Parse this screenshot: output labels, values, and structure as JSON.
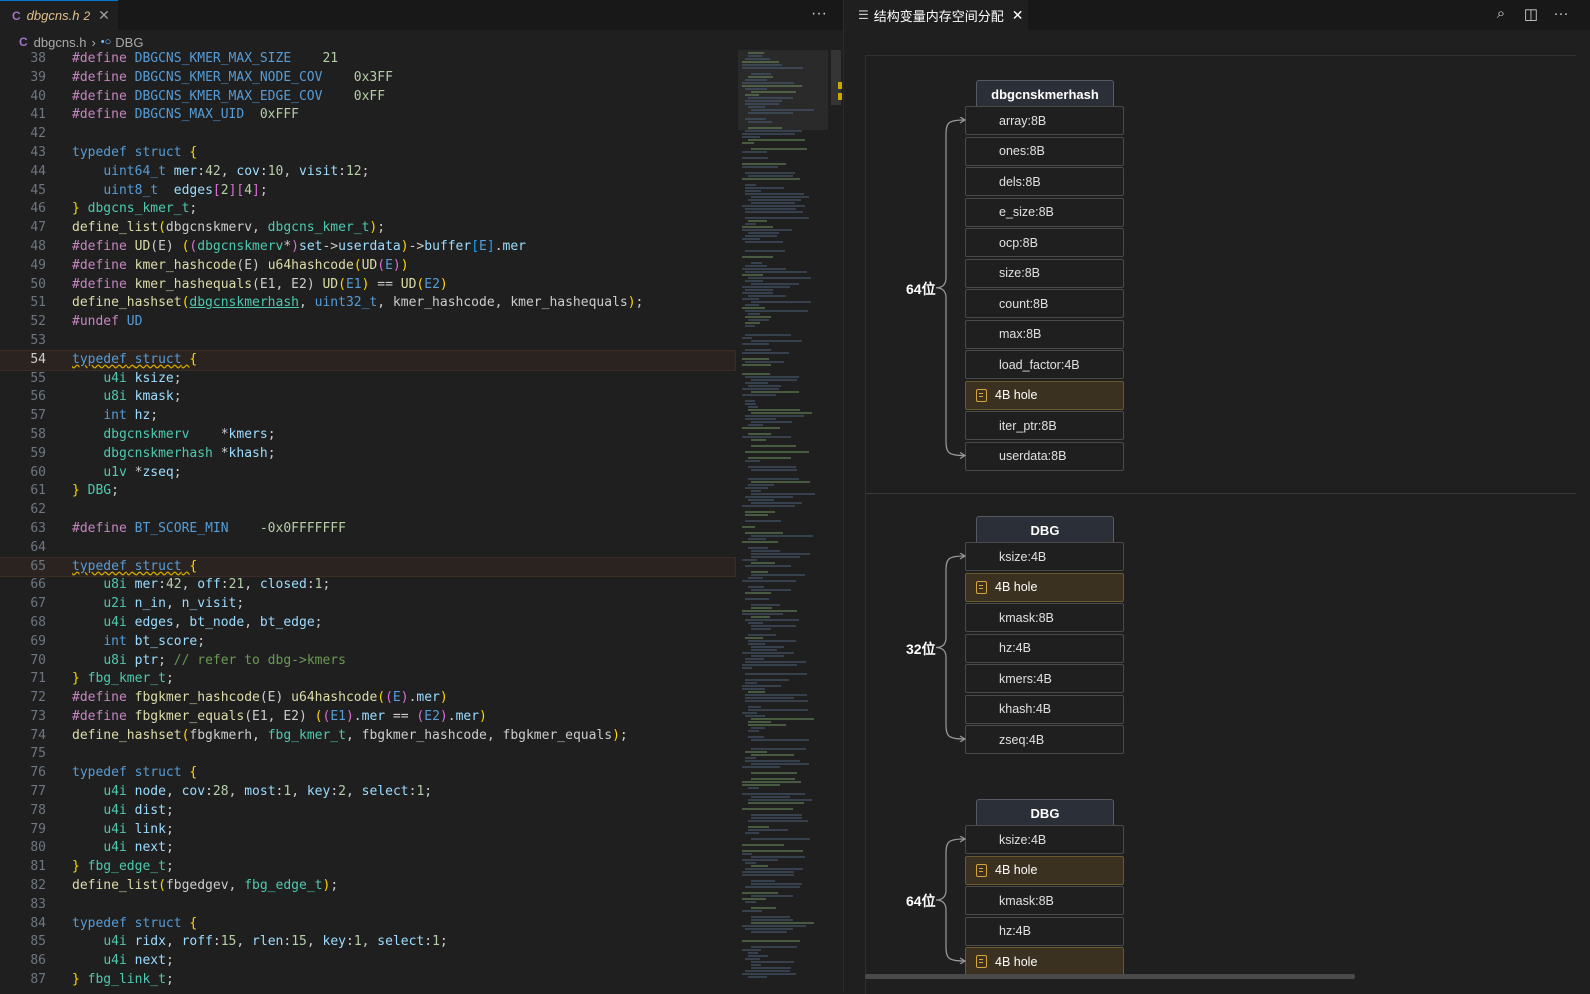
{
  "editor": {
    "tab": {
      "icon": "C",
      "filename": "dbgcns.h",
      "modified": "2",
      "close": "✕"
    },
    "more": "···",
    "breadcrumb": {
      "icon": "C",
      "file": "dbgcns.h",
      "sep": "›",
      "symbol_icon": "•○",
      "symbol": "DBG"
    }
  },
  "code_lines": [
    {
      "n": "38",
      "html": "<span class='pp'>#define</span> <span class='ma'>DBGCNS_KMER_MAX_SIZE</span>    <span class='nu'>21</span>"
    },
    {
      "n": "39",
      "html": "<span class='pp'>#define</span> <span class='ma'>DBGCNS_KMER_MAX_NODE_COV</span>    <span class='nu'>0x3FF</span>"
    },
    {
      "n": "40",
      "html": "<span class='pp'>#define</span> <span class='ma'>DBGCNS_KMER_MAX_EDGE_COV</span>    <span class='nu'>0xFF</span>"
    },
    {
      "n": "41",
      "html": "<span class='pp'>#define</span> <span class='ma'>DBGCNS_MAX_UID</span>  <span class='nu'>0xFFF</span>"
    },
    {
      "n": "42",
      "html": ""
    },
    {
      "n": "43",
      "html": "<span class='kw'>typedef</span> <span class='kw'>struct</span> <span class='br1'>{</span>"
    },
    {
      "n": "44",
      "html": "    <span class='kw'>uint64_t</span> <span class='va'>mer</span>:<span class='nu'>42</span>, <span class='va'>cov</span>:<span class='nu'>10</span>, <span class='va'>visit</span>:<span class='nu'>12</span>;"
    },
    {
      "n": "45",
      "html": "    <span class='kw'>uint8_t</span>  <span class='va'>edges</span><span class='br2'>[</span><span class='nu'>2</span><span class='br2'>]</span><span class='br2'>[</span><span class='nu'>4</span><span class='br2'>]</span>;"
    },
    {
      "n": "46",
      "html": "<span class='br1'>}</span> <span class='ty'>dbgcns_kmer_t</span>;"
    },
    {
      "n": "47",
      "html": "<span class='fn'>define_list</span><span class='br1'>(</span>dbgcnskmerv, <span class='ty'>dbgcns_kmer_t</span><span class='br1'>)</span>;"
    },
    {
      "n": "48",
      "html": "<span class='pp'>#define</span> <span class='fn'>UD</span>(E) <span class='br1'>(</span><span class='br2'>(</span><span class='ty'>dbgcnskmerv</span>*<span class='br2'>)</span><span class='va'>set</span>-&gt;<span class='va'>userdata</span><span class='br1'>)</span>-&gt;<span class='va'>buffer</span><span class='br3'>[</span><span class='ma'>E</span><span class='br3'>]</span>.<span class='va'>mer</span>"
    },
    {
      "n": "49",
      "html": "<span class='pp'>#define</span> <span class='fn'>kmer_hashcode</span>(E) <span class='fn'>u64hashcode</span><span class='br1'>(</span><span class='fn'>UD</span><span class='br2'>(</span><span class='ma'>E</span><span class='br2'>)</span><span class='br1'>)</span>"
    },
    {
      "n": "50",
      "html": "<span class='pp'>#define</span> <span class='fn'>kmer_hashequals</span>(E1, E2) <span class='fn'>UD</span><span class='br1'>(</span><span class='ma'>E1</span><span class='br1'>)</span> == <span class='fn'>UD</span><span class='br1'>(</span><span class='ma'>E2</span><span class='br1'>)</span>"
    },
    {
      "n": "51",
      "html": "<span class='fn'>define_hashset</span><span class='br1'>(</span><span class='ty ul'>dbgcnskmerhash</span>, <span class='kw'>uint32_t</span>, kmer_hashcode, kmer_hashequals<span class='br1'>)</span>;"
    },
    {
      "n": "52",
      "html": "<span class='pp'>#undef</span> <span class='ma'>UD</span>"
    },
    {
      "n": "53",
      "html": ""
    },
    {
      "n": "54",
      "html": "<span class='kw wavy'>typedef</span><span class='wavy'> </span><span class='kw wavy'>struct</span><span class='wavy'> </span><span class='br1'>{</span>",
      "active": true,
      "hl": true
    },
    {
      "n": "55",
      "html": "    <span class='ty'>u4i</span> <span class='va'>ksize</span>;"
    },
    {
      "n": "56",
      "html": "    <span class='ty'>u8i</span> <span class='va'>kmask</span>;"
    },
    {
      "n": "57",
      "html": "    <span class='kw'>int</span> <span class='va'>hz</span>;"
    },
    {
      "n": "58",
      "html": "    <span class='ty'>dbgcnskmerv</span>    *<span class='va'>kmers</span>;"
    },
    {
      "n": "59",
      "html": "    <span class='ty'>dbgcnskmerhash</span> *<span class='va'>khash</span>;"
    },
    {
      "n": "60",
      "html": "    <span class='ty'>u1v</span> *<span class='va'>zseq</span>;"
    },
    {
      "n": "61",
      "html": "<span class='br1'>}</span> <span class='ty'>DBG</span>;"
    },
    {
      "n": "62",
      "html": ""
    },
    {
      "n": "63",
      "html": "<span class='pp'>#define</span> <span class='ma'>BT_SCORE_MIN</span>    <span class='nu'>-0x0FFFFFFF</span>"
    },
    {
      "n": "64",
      "html": ""
    },
    {
      "n": "65",
      "html": "<span class='kw wavy'>typedef</span><span class='wavy'> </span><span class='kw wavy'>struct</span><span class='wavy'> </span><span class='br1'>{</span>",
      "hl": true
    },
    {
      "n": "66",
      "html": "    <span class='ty'>u8i</span> <span class='va'>mer</span>:<span class='nu'>42</span>, <span class='va'>off</span>:<span class='nu'>21</span>, <span class='va'>closed</span>:<span class='nu'>1</span>;"
    },
    {
      "n": "67",
      "html": "    <span class='ty'>u2i</span> <span class='va'>n_in</span>, <span class='va'>n_visit</span>;"
    },
    {
      "n": "68",
      "html": "    <span class='ty'>u4i</span> <span class='va'>edges</span>, <span class='va'>bt_node</span>, <span class='va'>bt_edge</span>;"
    },
    {
      "n": "69",
      "html": "    <span class='kw'>int</span> <span class='va'>bt_score</span>;"
    },
    {
      "n": "70",
      "html": "    <span class='ty'>u8i</span> <span class='va'>ptr</span>; <span class='cm'>// refer to dbg-&gt;kmers</span>"
    },
    {
      "n": "71",
      "html": "<span class='br1'>}</span> <span class='ty'>fbg_kmer_t</span>;"
    },
    {
      "n": "72",
      "html": "<span class='pp'>#define</span> <span class='fn'>fbgkmer_hashcode</span>(E) <span class='fn'>u64hashcode</span><span class='br1'>(</span><span class='br2'>(</span><span class='ma'>E</span><span class='br2'>)</span>.<span class='va'>mer</span><span class='br1'>)</span>"
    },
    {
      "n": "73",
      "html": "<span class='pp'>#define</span> <span class='fn'>fbgkmer_equals</span>(E1, E2) <span class='br1'>(</span><span class='br2'>(</span><span class='ma'>E1</span><span class='br2'>)</span>.<span class='va'>mer</span> == <span class='br2'>(</span><span class='ma'>E2</span><span class='br2'>)</span>.<span class='va'>mer</span><span class='br1'>)</span>"
    },
    {
      "n": "74",
      "html": "<span class='fn'>define_hashset</span><span class='br1'>(</span>fbgkmerh, <span class='ty'>fbg_kmer_t</span>, fbgkmer_hashcode, fbgkmer_equals<span class='br1'>)</span>;"
    },
    {
      "n": "75",
      "html": ""
    },
    {
      "n": "76",
      "html": "<span class='kw'>typedef</span> <span class='kw'>struct</span> <span class='br1'>{</span>"
    },
    {
      "n": "77",
      "html": "    <span class='ty'>u4i</span> <span class='va'>node</span>, <span class='va'>cov</span>:<span class='nu'>28</span>, <span class='va'>most</span>:<span class='nu'>1</span>, <span class='va'>key</span>:<span class='nu'>2</span>, <span class='va'>select</span>:<span class='nu'>1</span>;"
    },
    {
      "n": "78",
      "html": "    <span class='ty'>u4i</span> <span class='va'>dist</span>;"
    },
    {
      "n": "79",
      "html": "    <span class='ty'>u4i</span> <span class='va'>link</span>;"
    },
    {
      "n": "80",
      "html": "    <span class='ty'>u4i</span> <span class='va'>next</span>;"
    },
    {
      "n": "81",
      "html": "<span class='br1'>}</span> <span class='ty'>fbg_edge_t</span>;"
    },
    {
      "n": "82",
      "html": "<span class='fn'>define_list</span><span class='br1'>(</span>fbgedgev, <span class='ty'>fbg_edge_t</span><span class='br1'>)</span>;"
    },
    {
      "n": "83",
      "html": ""
    },
    {
      "n": "84",
      "html": "<span class='kw'>typedef</span> <span class='kw'>struct</span> <span class='br1'>{</span>"
    },
    {
      "n": "85",
      "html": "    <span class='ty'>u4i</span> <span class='va'>ridx</span>, <span class='va'>roff</span>:<span class='nu'>15</span>, <span class='va'>rlen</span>:<span class='nu'>15</span>, <span class='va'>key</span>:<span class='nu'>1</span>, <span class='va'>select</span>:<span class='nu'>1</span>;"
    },
    {
      "n": "86",
      "html": "    <span class='ty'>u4i</span> <span class='va'>next</span>;"
    },
    {
      "n": "87",
      "html": "<span class='br1'>}</span> <span class='ty'>fbg_link_t</span>;"
    }
  ],
  "panel": {
    "tab_title": "结构变量内存空间分配",
    "tab_icon": "☰",
    "close": "✕",
    "actions": {
      "search": "⌕",
      "split": "◫",
      "more": "···"
    },
    "groups": [
      {
        "title": "dbgcnskmerhash",
        "bits": "64位",
        "fields": [
          {
            "label": "array:8B"
          },
          {
            "label": "ones:8B"
          },
          {
            "label": "dels:8B"
          },
          {
            "label": "e_size:8B"
          },
          {
            "label": "ocp:8B"
          },
          {
            "label": "size:8B"
          },
          {
            "label": "count:8B"
          },
          {
            "label": "max:8B"
          },
          {
            "label": "load_factor:4B"
          },
          {
            "label": "4B hole",
            "hole": true
          },
          {
            "label": "iter_ptr:8B"
          },
          {
            "label": "userdata:8B"
          }
        ]
      },
      {
        "title": "DBG",
        "bits": "32位",
        "fields": [
          {
            "label": "ksize:4B"
          },
          {
            "label": "4B hole",
            "hole": true
          },
          {
            "label": "kmask:8B"
          },
          {
            "label": "hz:4B"
          },
          {
            "label": "kmers:4B"
          },
          {
            "label": "khash:4B"
          },
          {
            "label": "zseq:4B"
          }
        ]
      },
      {
        "title": "DBG",
        "bits": "64位",
        "fields": [
          {
            "label": "ksize:4B"
          },
          {
            "label": "4B hole",
            "hole": true
          },
          {
            "label": "kmask:8B"
          },
          {
            "label": "hz:4B"
          },
          {
            "label": "4B hole",
            "hole": true
          }
        ]
      }
    ]
  }
}
